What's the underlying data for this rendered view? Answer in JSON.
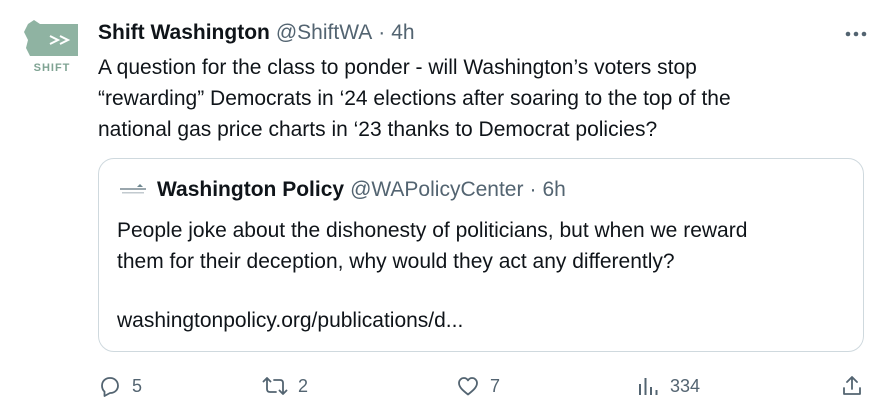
{
  "tweet": {
    "avatar_text": "SHIFT",
    "display_name": "Shift Washington",
    "handle": "@ShiftWA",
    "separator": "·",
    "time": "4h",
    "text": "A question for the class to ponder - will Washington’s voters stop\n“rewarding” Democrats in ‘24 elections after soaring to the top of the\nnational gas price charts in ‘23 thanks to Democrat policies?"
  },
  "quote": {
    "display_name": "Washington Policy",
    "handle": "@WAPolicyCenter",
    "separator": "·",
    "time": "6h",
    "text": "People joke about the dishonesty of politicians, but when we reward\nthem for their deception, why would they act any differently?",
    "link": "washingtonpolicy.org/publications/d..."
  },
  "actions": {
    "replies": "5",
    "retweets": "2",
    "likes": "7",
    "views": "334"
  },
  "icons": {
    "more": "more-icon",
    "reply": "reply-icon",
    "retweet": "retweet-icon",
    "like": "heart-icon",
    "views": "views-icon",
    "share": "share-icon"
  },
  "colors": {
    "text": "#0f1419",
    "secondary": "#536471",
    "border": "#cfd9de",
    "avatar_green": "#7fa393"
  }
}
